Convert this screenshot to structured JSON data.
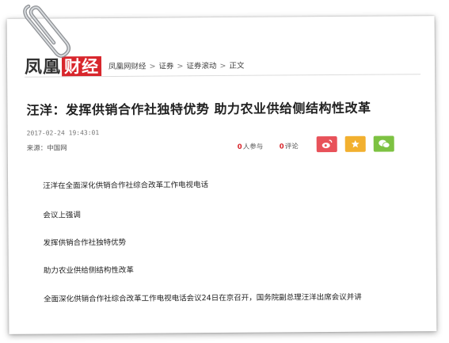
{
  "header": {
    "logo_main": "凤凰",
    "logo_accent": "财经",
    "breadcrumbs": [
      "凤凰网财经",
      "证券",
      "证券滚动",
      "正文"
    ]
  },
  "article": {
    "title": "汪洋：发挥供销合作社独特优势 助力农业供给侧结构性改革",
    "time": "2017-02-24 19:43:01",
    "source": "来源：中国网",
    "participants_count": "0",
    "participants_label": "人参与",
    "comments_count": "0",
    "comments_label": "评论",
    "paragraphs": [
      "汪洋在全面深化供销合作社综合改革工作电视电话",
      "会议上强调",
      "发挥供销合作社独特优势",
      "助力农业供给侧结构性改革",
      "全面深化供销合作社综合改革工作电视电话会议24日在京召开，国务院副总理汪洋出席会议并讲"
    ]
  },
  "share": {
    "weibo_icon": "weibo-icon",
    "favorite_icon": "star-icon",
    "wechat_icon": "wechat-icon",
    "colors": {
      "weibo": "#e8525a",
      "favorite": "#f2b02f",
      "wechat": "#7dc242"
    }
  }
}
